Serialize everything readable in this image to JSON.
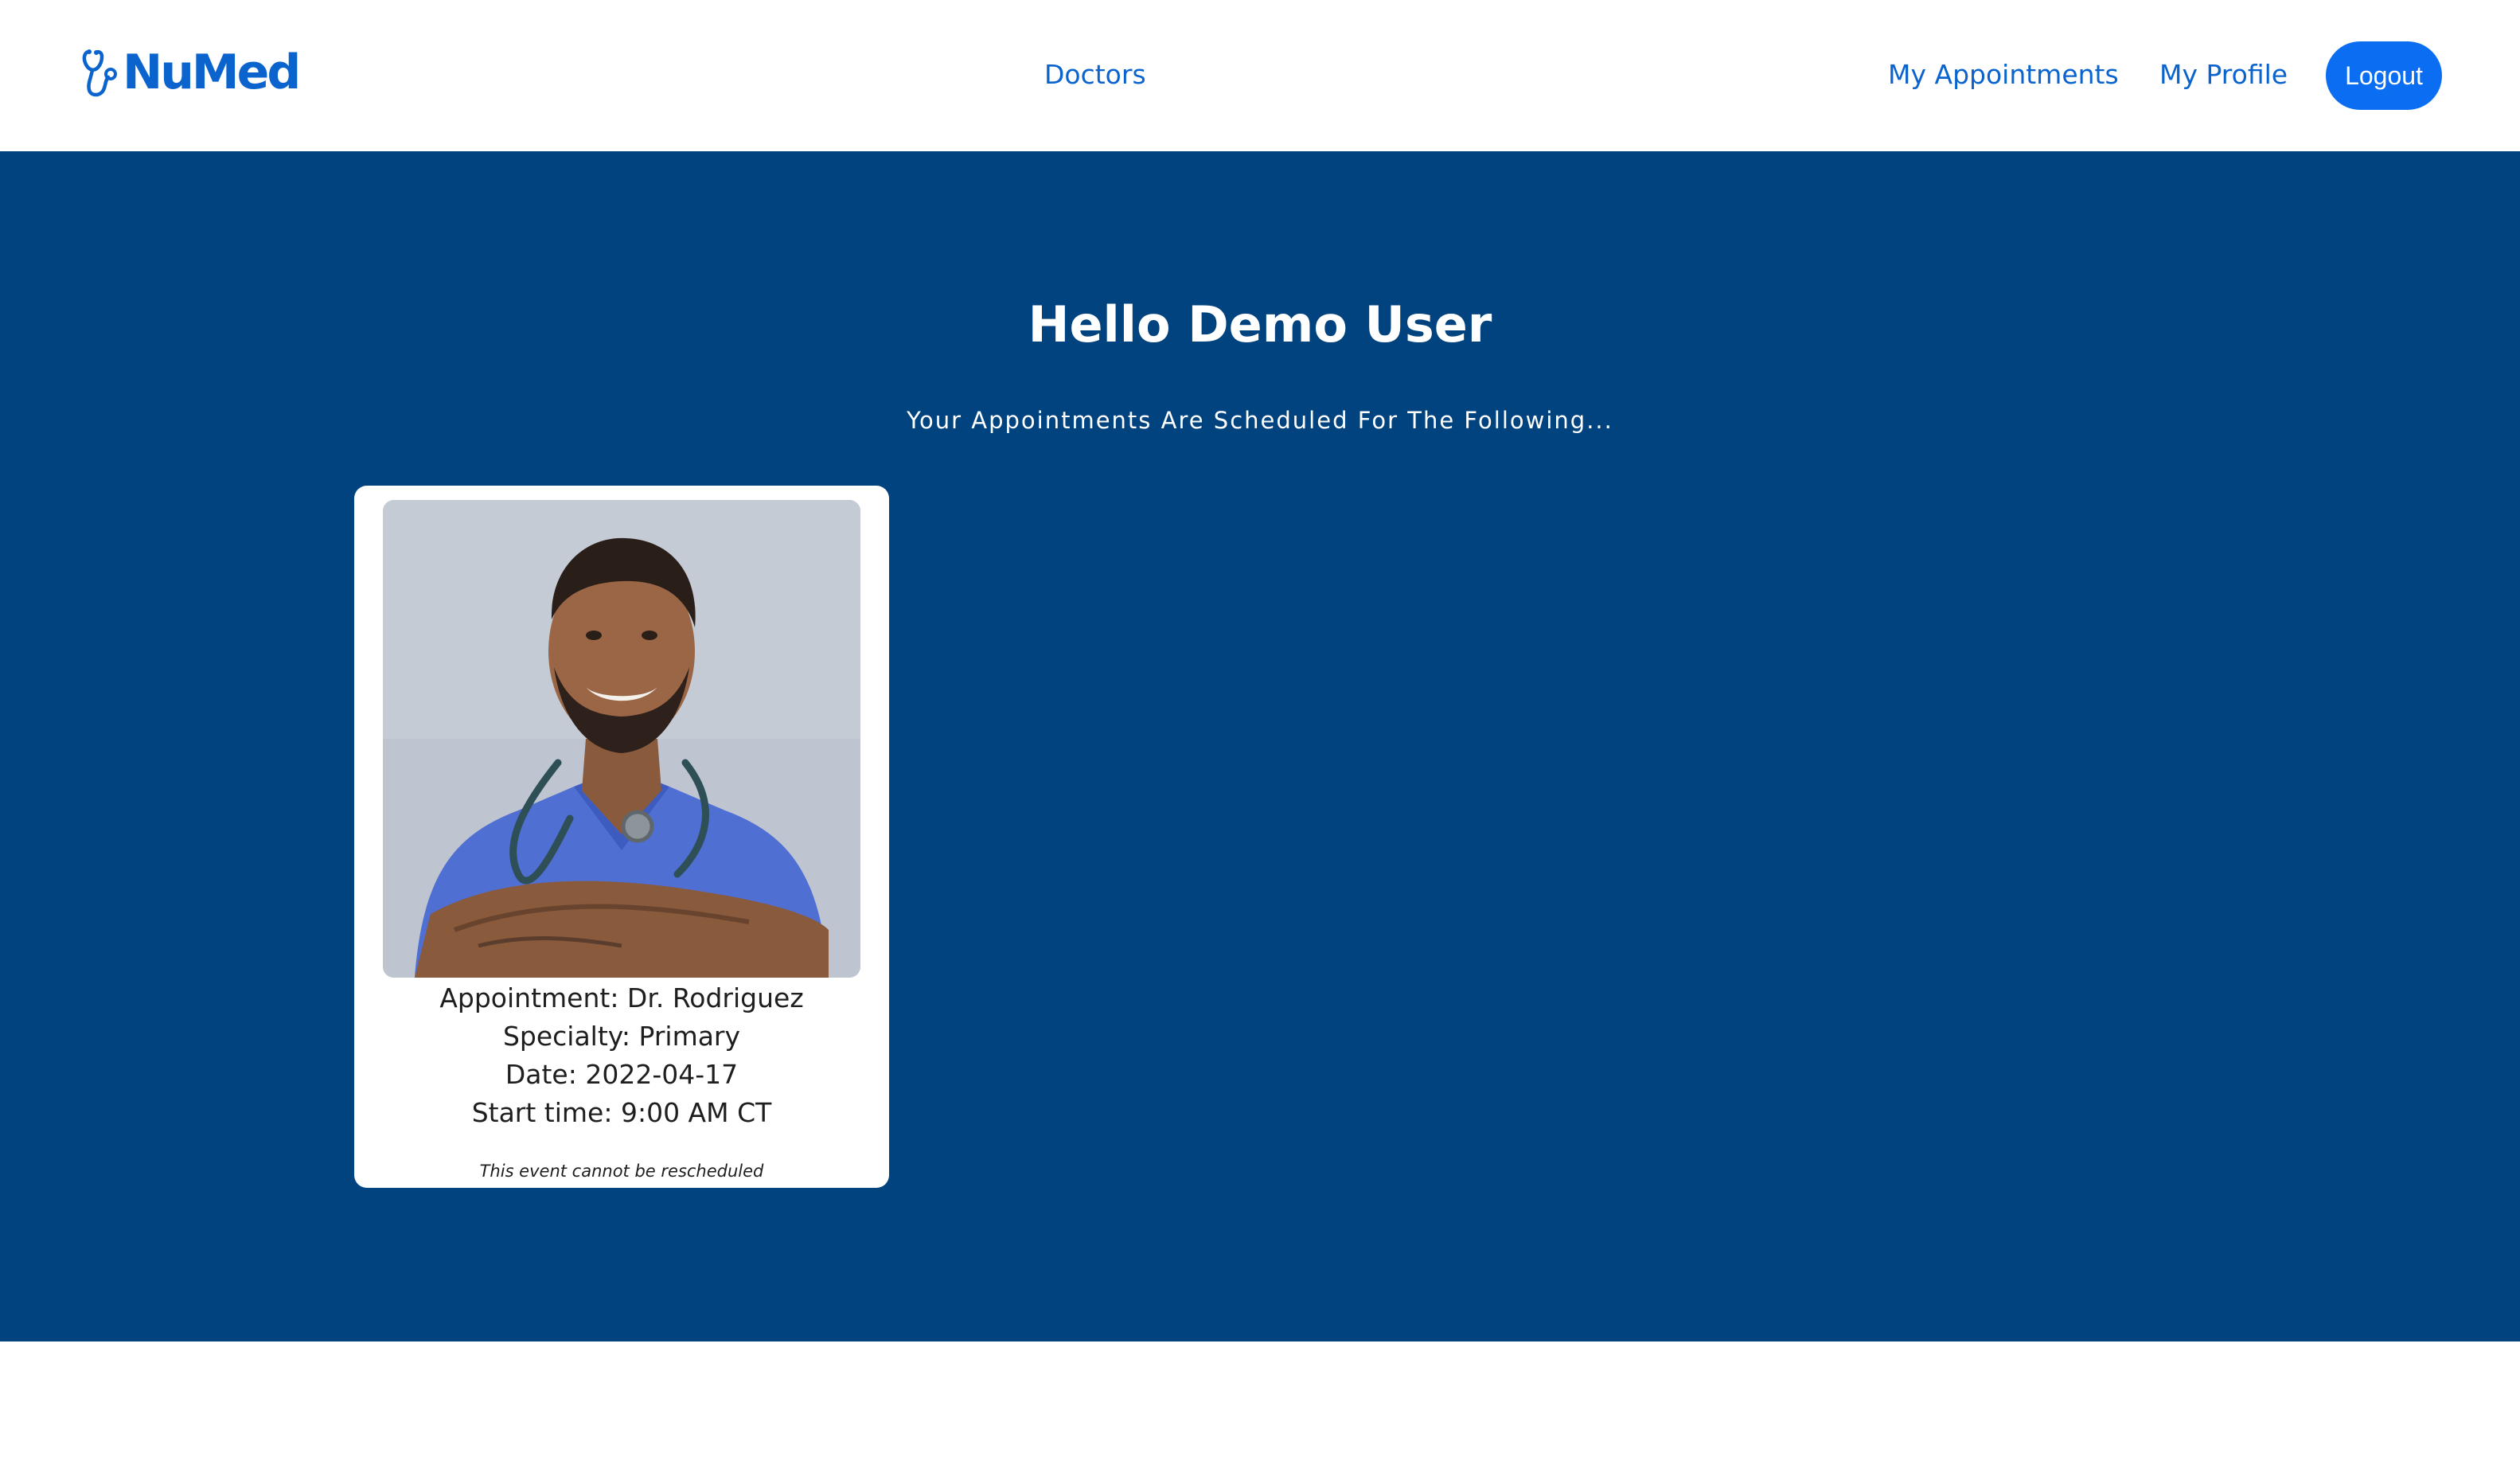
{
  "header": {
    "logo_text": "NuMed",
    "nav": {
      "doctors": "Doctors",
      "my_appointments": "My Appointments",
      "my_profile": "My Profile"
    },
    "logout_label": "Logout"
  },
  "hero": {
    "title": "Hello Demo User",
    "subtitle": "Your Appointments Are Scheduled For The Following..."
  },
  "appointments": [
    {
      "doctor": "Appointment: Dr. Rodriguez",
      "specialty": "Specialty: Primary",
      "date": "Date: 2022-04-17",
      "start_time": "Start time: 9:00 AM CT",
      "note": "This event cannot be rescheduled"
    }
  ],
  "colors": {
    "brand_blue": "#0b63ce",
    "logout_button": "#0b6ef2",
    "hero_background": "#00437f",
    "card_background": "#ffffff"
  },
  "icons": {
    "logo": "stethoscope-icon"
  }
}
